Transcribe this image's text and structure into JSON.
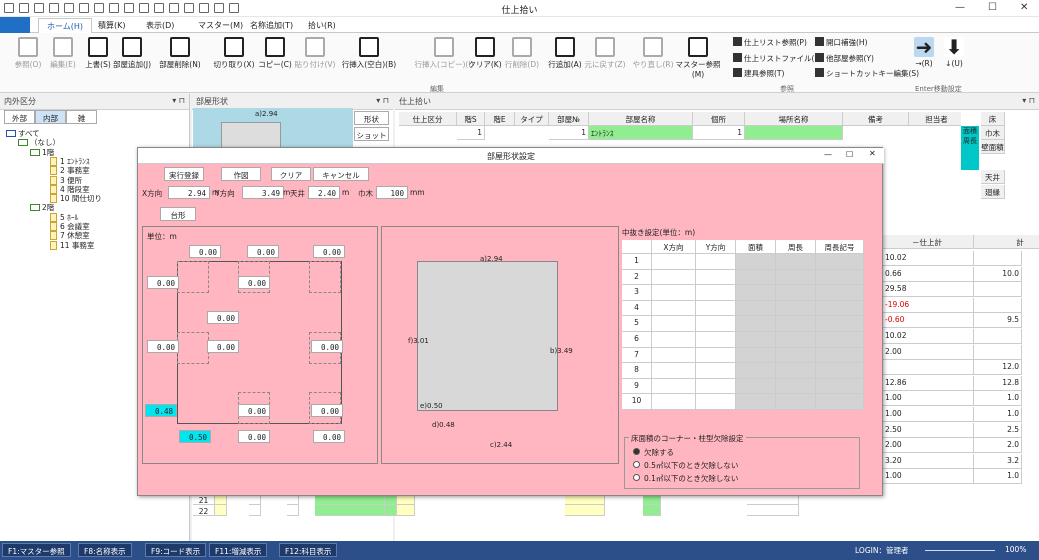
{
  "app": {
    "title": "仕上拾い",
    "win": {
      "min": "—",
      "max": "☐",
      "close": "✕"
    }
  },
  "tabs": [
    "ホーム(H)",
    "積算(K)",
    "表示(D)",
    "マスター(M)",
    "名称追加(T)",
    "拾い(R)"
  ],
  "ribbon": {
    "buttons": [
      {
        "label": "参照(O)",
        "icon": "table-view-icon",
        "dis": true
      },
      {
        "label": "編集(E)",
        "icon": "edit-table-icon",
        "dis": true
      },
      {
        "label": "上書(S)",
        "icon": "save-icon"
      },
      {
        "label": "部屋追加(J)",
        "icon": "add-room-icon"
      },
      {
        "label": "部屋削除(N)",
        "icon": "delete-room-icon"
      },
      {
        "label": "切り取り(X)",
        "icon": "scissors-icon"
      },
      {
        "label": "コピー(C)",
        "icon": "copy-icon"
      },
      {
        "label": "貼り付け(V)",
        "icon": "paste-icon",
        "dis": true
      },
      {
        "label": "行挿入(空白)(B)",
        "icon": "insert-row-icon"
      },
      {
        "label": "行挿入(コピー)(I)",
        "icon": "insert-copy-row-icon",
        "dis": true
      },
      {
        "label": "クリア(K)",
        "icon": "clear-icon"
      },
      {
        "label": "行削除(D)",
        "icon": "delete-row-icon",
        "dis": true
      },
      {
        "label": "行追加(A)",
        "icon": "add-row-icon"
      },
      {
        "label": "元に戻す(Z)",
        "icon": "undo-icon",
        "dis": true
      },
      {
        "label": "やり直し(R)",
        "icon": "redo-icon",
        "dis": true
      },
      {
        "label": "マスター参照(M)",
        "icon": "book-icon"
      }
    ],
    "small": [
      "仕上リスト参照(P)",
      "仕上リストファイル(L)",
      "建具参照(T)",
      "開口補強(H)",
      "他部屋参照(Y)",
      "ショートカットキー編集(S)"
    ],
    "enter": [
      "→(R)",
      "↓(U)"
    ],
    "groups": [
      "編集",
      "参照",
      "Enter移動設定"
    ]
  },
  "left": {
    "title": "内外区分",
    "pin": "▾  ⊓",
    "tabs": [
      "外部",
      "内部",
      "雑"
    ],
    "tree": [
      "すべて",
      "（なし）",
      "1階",
      "1 ｴﾝﾄﾗﾝｽ",
      "2 事務室",
      "3 便所",
      "4 階段室",
      "10 間仕切り",
      "2階",
      "5 ﾎｰﾙ",
      "6 会議室",
      "7 休憩室",
      "11 事務室"
    ]
  },
  "mid": {
    "title": "部屋形状",
    "dim": "a)2.94",
    "btn1": "形状",
    "btn2": "ショット"
  },
  "right": {
    "title": "仕上拾い",
    "headers": [
      "仕上区分",
      "階S",
      "階E",
      "タイプ",
      "部屋№",
      "部屋名称",
      "個所",
      "場所名称",
      "備考",
      "担当者"
    ],
    "row1": {
      "kaiS": "1",
      "no": "1",
      "name": "ｴﾝﾄﾗﾝｽ",
      "count": "1"
    },
    "side": {
      "floor": "床",
      "men": "面積",
      "shu": "周長",
      "habaki": "巾木",
      "kabe": "壁面積",
      "tenjo": "天井",
      "mawari": "廻縁"
    },
    "sum_head": [
      "－仕上計",
      "計"
    ],
    "sums": [
      "10.02",
      "0.66",
      "29.58",
      "-19.06",
      "-0.60",
      "10.02",
      "2.00",
      "",
      "12.86",
      "1.00",
      "1.00",
      "2.50",
      "2.00",
      "3.20",
      "1.00"
    ],
    "totals": [
      "",
      "10.0",
      "",
      "",
      "9.5",
      "",
      "",
      "12.0",
      "12.8",
      "1.0",
      "1.0",
      "2.5",
      "2.0",
      "3.2",
      "1.0"
    ],
    "rows": [
      "21",
      "22"
    ]
  },
  "dialog": {
    "title": "部屋形状設定",
    "buttons": [
      "実行登録",
      "作図",
      "クリア",
      "キャンセル",
      "台形"
    ],
    "x_label": "X方向",
    "x": "2.94",
    "y_label": "Y方向",
    "y": "3.49",
    "ten_label": "天井",
    "ten": "2.40",
    "hab_label": "巾木",
    "hab": "100",
    "m": "m",
    "mm": "mm",
    "unit": "単位：m",
    "fields": [
      "0.00",
      "0.00",
      "0.00",
      "0.00",
      "0.00",
      "0.00",
      "0.00",
      "0.00",
      "0.00",
      "0.48",
      "0.00",
      "0.00",
      "0.50",
      "0.00",
      "0.00"
    ],
    "preview": {
      "a": "a)2.94",
      "b": "b)3.49",
      "c": "c)2.44",
      "d": "d)0.48",
      "e": "e)0.50",
      "f": "f)3.01"
    },
    "grid_title": "中抜き設定(単位：m)",
    "grid_head": [
      "",
      "X方向",
      "Y方向",
      "面積",
      "周長",
      "周長記号"
    ],
    "grid_rows": [
      "1",
      "2",
      "3",
      "4",
      "5",
      "6",
      "7",
      "8",
      "9",
      "10"
    ],
    "corner_title": "床面積のコーナー・柱型欠除設定",
    "radios": [
      "欠除する",
      "0.5㎡以下のとき欠除しない",
      "0.1㎡以下のとき欠除しない"
    ]
  },
  "status": {
    "keys": [
      "F1:マスター参照",
      "F8:名称表示",
      "F9:コード表示",
      "F11:増減表示",
      "F12:科目表示"
    ],
    "login": "LOGIN：管理者",
    "zoom": "100%"
  }
}
